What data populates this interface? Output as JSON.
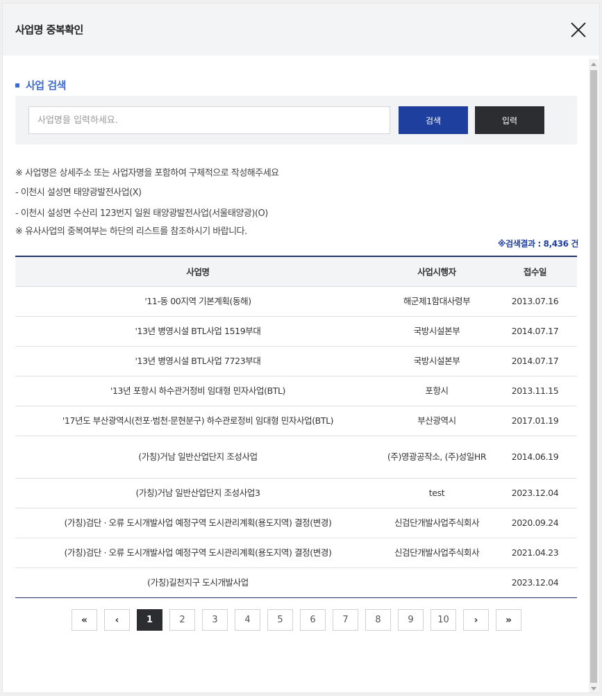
{
  "modal": {
    "title": "사업명 중복확인"
  },
  "search": {
    "section_title": "사업 검색",
    "placeholder": "사업명을 입력하세요.",
    "search_label": "검색",
    "input_label": "입력"
  },
  "notes": [
    "※ 사업명은 상세주소 또는 사업자명을 포함하여 구체적으로 작성해주세요",
    "- 이천시 설성면 태양광발전사업(X)",
    "- 이천시 설성면 수산리 123번지 일원 태양광발전사업(서울태양광)(O)",
    "※ 유사사업의 중복여부는 하단의 리스트를 참조하시기 바랍니다."
  ],
  "result_count": "※검색결과 : 8,436 건",
  "table": {
    "headers": [
      "사업명",
      "사업시행자",
      "접수일"
    ],
    "rows": [
      [
        "'11-동 00지역 기본계획(동해)",
        "해군제1함대사령부",
        "2013.07.16"
      ],
      [
        "'13년 병영시설 BTL사업 1519부대",
        "국방시설본부",
        "2014.07.17"
      ],
      [
        "'13년 병영시설 BTL사업 7723부대",
        "국방시설본부",
        "2014.07.17"
      ],
      [
        "'13년 포항시 하수관거정비 임대형 민자사업(BTL)",
        "포항시",
        "2013.11.15"
      ],
      [
        "'17년도 부산광역시(전포·범천·문현분구) 하수관로정비 임대형 민자사업(BTL)",
        "부산광역시",
        "2017.01.19"
      ],
      [
        "(가칭)거남 일반산업단지 조성사업",
        "(주)영광공작소, (주)성일HR",
        "2014.06.19"
      ],
      [
        "(가칭)거남 일반산업단지 조성사업3",
        "test",
        "2023.12.04"
      ],
      [
        "(가칭)검단 · 오류 도시개발사업 예정구역 도시관리계획(용도지역) 결정(변경)",
        "신검단개발사업주식회사",
        "2020.09.24"
      ],
      [
        "(가칭)검단 · 오류 도시개발사업 예정구역 도시관리계획(용도지역) 결정(변경)",
        "신검단개발사업주식회사",
        "2021.04.23"
      ],
      [
        "(가칭)길천지구 도시개발사업",
        "",
        "2023.12.04"
      ]
    ]
  },
  "pagination": {
    "first": "«",
    "prev": "‹",
    "pages": [
      "1",
      "2",
      "3",
      "4",
      "5",
      "6",
      "7",
      "8",
      "9",
      "10"
    ],
    "active": "1",
    "next": "›",
    "last": "»"
  }
}
